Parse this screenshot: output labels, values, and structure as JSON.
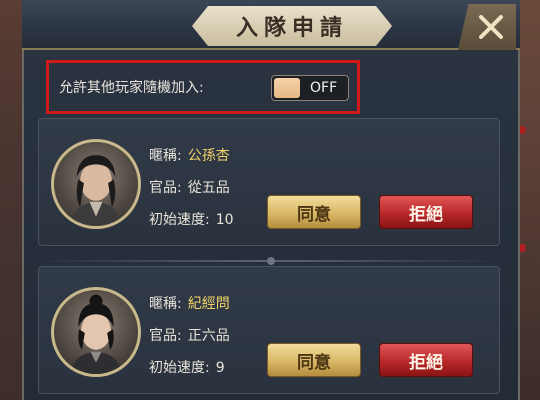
{
  "dialog": {
    "title": "入隊申請"
  },
  "toggle": {
    "label": "允許其他玩家隨機加入:",
    "state": "OFF"
  },
  "labels": {
    "nickname": "暱稱:",
    "rank": "官品:",
    "speed": "初始速度:"
  },
  "requests": [
    {
      "name": "公孫杏",
      "rank": "從五品",
      "speed": "10",
      "agree": "同意",
      "reject": "拒絕"
    },
    {
      "name": "紀經問",
      "rank": "正六品",
      "speed": "9",
      "agree": "同意",
      "reject": "拒絕"
    }
  ],
  "colors": {
    "name": "#f0d267",
    "highlight": "#d01a1a",
    "agree": "#d9b766",
    "reject": "#b8282a"
  }
}
